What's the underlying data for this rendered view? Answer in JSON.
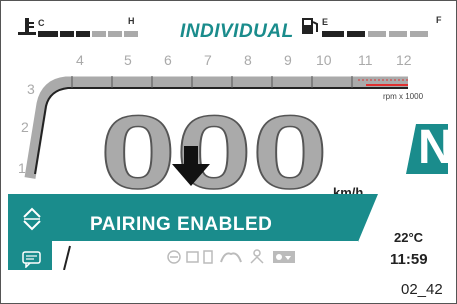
{
  "mode": "INDIVIDUAL",
  "coolant": {
    "low_label": "C",
    "high_label": "H"
  },
  "fuel": {
    "empty_label": "E",
    "full_label": "F"
  },
  "tach": {
    "ticks": [
      "1",
      "2",
      "3",
      "4",
      "5",
      "6",
      "7",
      "8",
      "9",
      "10",
      "11",
      "12"
    ],
    "unit": "rpm x 1000"
  },
  "speed": {
    "value": "000",
    "unit": "km/h"
  },
  "gear": "N",
  "notification": {
    "text": "PAIRING ENABLED"
  },
  "ambient_temp": "22°C",
  "clock": "11:59",
  "figure_ref": "02_42",
  "colors": {
    "accent": "#1a8c8c",
    "segments": "#aaaaaa",
    "redline": "#e03030"
  },
  "icons": [
    "coolant-temp-icon",
    "fuel-pump-icon",
    "speed-down-arrow-icon",
    "scroll-arrows-icon",
    "message-icon",
    "indicator-icon-1",
    "indicator-icon-2",
    "indicator-icon-3",
    "indicator-icon-4",
    "indicator-icon-5",
    "indicator-icon-6"
  ]
}
